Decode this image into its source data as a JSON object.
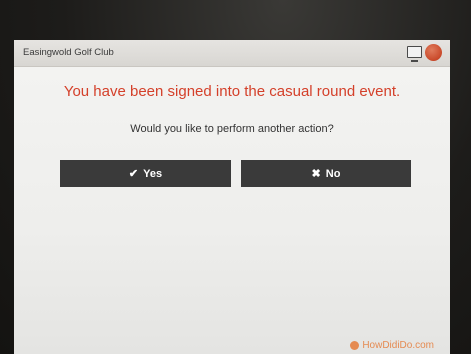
{
  "window": {
    "title": "Easingwold Golf Club"
  },
  "message": {
    "headline": "You have been signed into the casual round event.",
    "question": "Would you like to perform another action?"
  },
  "buttons": {
    "yes": {
      "icon": "checkmark-icon",
      "label": "Yes"
    },
    "no": {
      "icon": "close-icon",
      "label": "No"
    }
  },
  "footer": {
    "watermark": "HowDidiDo.com"
  },
  "colors": {
    "headline": "#d4402a",
    "button_bg": "#3a3a3a",
    "status_dot": "#c9492a"
  }
}
